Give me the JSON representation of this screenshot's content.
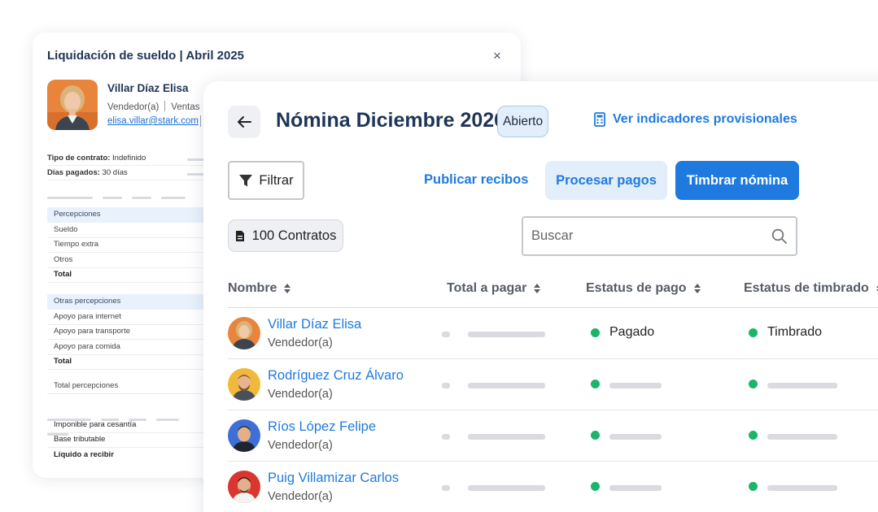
{
  "colors": {
    "accent": "#1f7ae0",
    "success": "#1bb56a",
    "title": "#1e3557"
  },
  "icons": {
    "close": "close-icon",
    "back": "arrow-left-icon",
    "calculator": "calculator-icon",
    "filter": "filter-icon",
    "document": "document-icon",
    "search": "search-icon",
    "sort": "sort-icon"
  },
  "payslip": {
    "title": "Liquidación de sueldo | Abril 2025",
    "close_label": "×",
    "employee": {
      "name": "Villar Díaz Elisa",
      "role": "Vendedor(a)",
      "area": "Ventas",
      "email": "elisa.villar@stark.com"
    },
    "info": [
      {
        "label": "Tipo de contrato:",
        "value": "Indefinido"
      },
      {
        "label": "Días pagados:",
        "value": "30 días"
      }
    ],
    "perceptions": {
      "header": "Percepciones",
      "items": [
        "Sueldo",
        "Tiempo extra",
        "Otros"
      ],
      "total": "Total"
    },
    "other_perceptions": {
      "header": "Otras percepciones",
      "items": [
        "Apoyo para internet",
        "Apoyo para transporte",
        "Apoyo para comida"
      ],
      "total": "Total"
    },
    "total_perceptions": "Total percepciones",
    "summary": [
      "Imponible para cesantía",
      "Base tributable",
      "Líquido a recibir"
    ]
  },
  "payroll": {
    "title": "Nómina Diciembre 2026",
    "status": "Abierto",
    "indicators_link": "Ver indicadores provisionales",
    "filter_label": "Filtrar",
    "publish_label": "Publicar recibos",
    "process_label": "Procesar pagos",
    "stamp_label": "Timbrar nómina",
    "contracts_label": "100 Contratos",
    "search_placeholder": "Buscar",
    "columns": [
      "Nombre",
      "Total a pagar",
      "Estatus de pago",
      "Estatus de timbrado"
    ],
    "rows": [
      {
        "name": "Villar Díaz Elisa",
        "role": "Vendedor(a)",
        "payment_status": "Pagado",
        "stamp_status": "Timbrado"
      },
      {
        "name": "Rodríguez Cruz Álvaro",
        "role": "Vendedor(a)"
      },
      {
        "name": "Ríos López Felipe",
        "role": "Vendedor(a)"
      },
      {
        "name": "Puig Villamizar Carlos",
        "role": "Vendedor(a)"
      }
    ]
  }
}
